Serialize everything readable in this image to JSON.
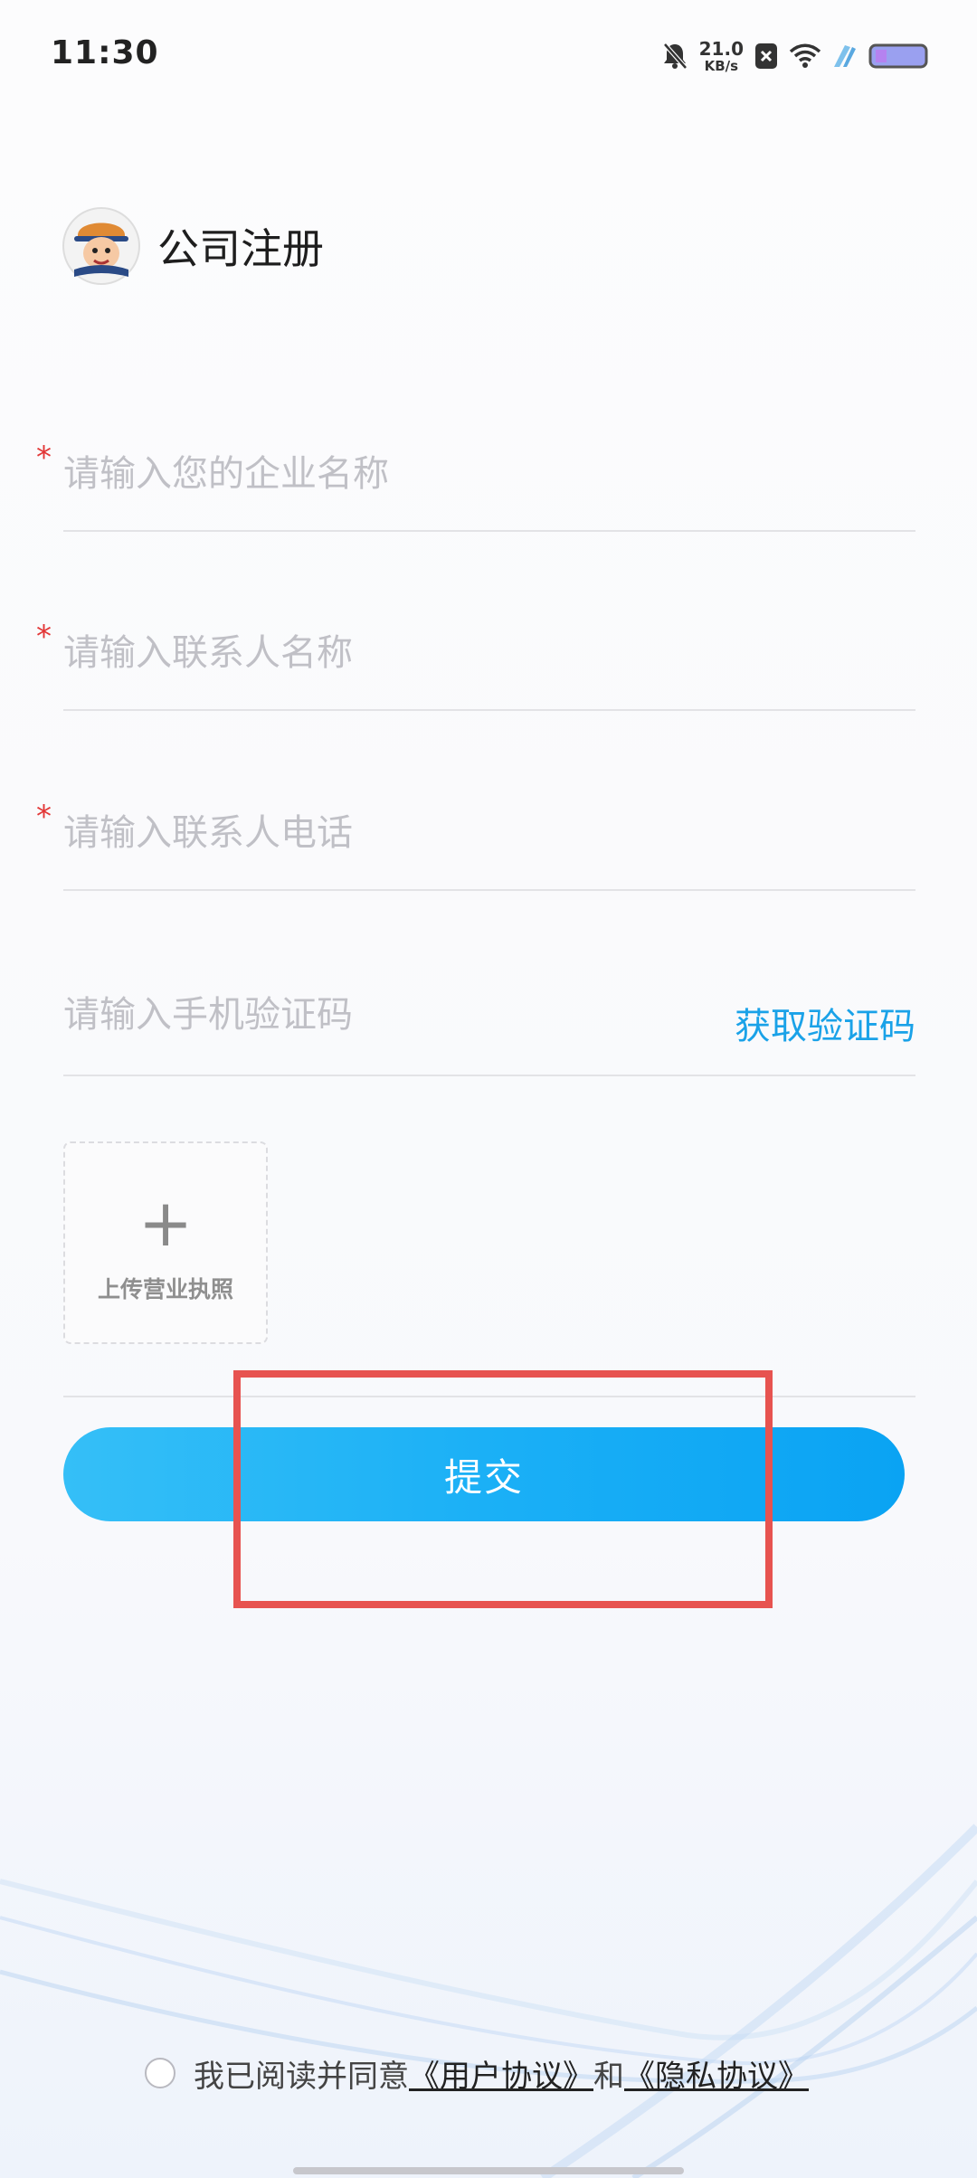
{
  "status_bar": {
    "time": "11:30",
    "net_speed_value": "21.0",
    "net_speed_unit": "KB/s",
    "icons": [
      "bell-muted-icon",
      "notification-x-icon",
      "wifi-icon",
      "charging-icon",
      "battery-icon"
    ]
  },
  "header": {
    "title": "公司注册",
    "logo_icon": "avatar-logo"
  },
  "form": {
    "required_mark": "*",
    "company_name": {
      "placeholder": "请输入您的企业名称",
      "value": ""
    },
    "contact_name": {
      "placeholder": "请输入联系人名称",
      "value": ""
    },
    "contact_phone": {
      "placeholder": "请输入联系人电话",
      "value": ""
    },
    "verification_code": {
      "placeholder": "请输入手机验证码",
      "value": "",
      "action_label": "获取验证码"
    },
    "upload": {
      "icon": "+",
      "label": "上传营业执照"
    },
    "submit_label": "提交"
  },
  "agreement": {
    "prefix": "我已阅读并同意",
    "user_agreement": "《用户协议》",
    "conjunction": "和",
    "privacy_agreement": "《隐私协议》"
  },
  "colors": {
    "accent": "#1aa2e8",
    "button_gradient_start": "#35bff7",
    "button_gradient_end": "#0aa3f3",
    "required": "#e23636",
    "highlight_box": "#e75350"
  }
}
